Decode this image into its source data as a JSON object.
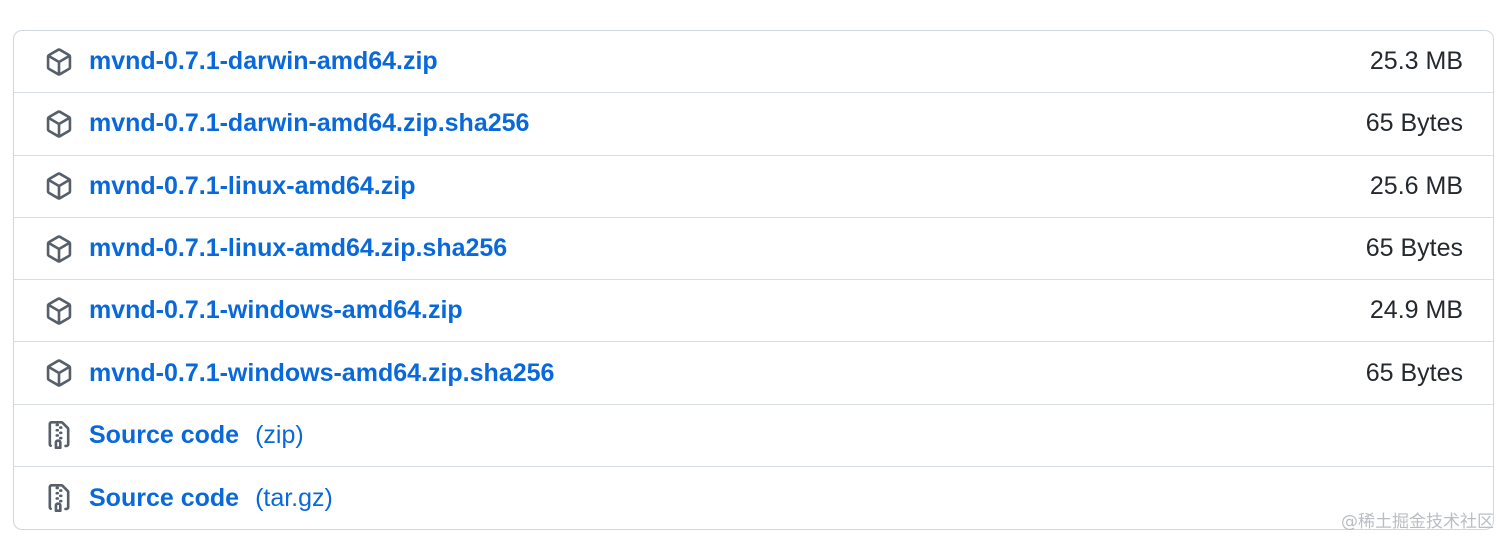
{
  "assets": [
    {
      "name": "mvnd-0.7.1-darwin-amd64.zip",
      "size": "25.3 MB",
      "icon": "package-icon"
    },
    {
      "name": "mvnd-0.7.1-darwin-amd64.zip.sha256",
      "size": "65 Bytes",
      "icon": "package-icon"
    },
    {
      "name": "mvnd-0.7.1-linux-amd64.zip",
      "size": "25.6 MB",
      "icon": "package-icon"
    },
    {
      "name": "mvnd-0.7.1-linux-amd64.zip.sha256",
      "size": "65 Bytes",
      "icon": "package-icon"
    },
    {
      "name": "mvnd-0.7.1-windows-amd64.zip",
      "size": "24.9 MB",
      "icon": "package-icon"
    },
    {
      "name": "mvnd-0.7.1-windows-amd64.zip.sha256",
      "size": "65 Bytes",
      "icon": "package-icon"
    }
  ],
  "source_code": [
    {
      "label": "Source code",
      "ext": "(zip)",
      "icon": "file-zip-icon"
    },
    {
      "label": "Source code",
      "ext": "(tar.gz)",
      "icon": "file-zip-icon"
    }
  ],
  "watermark": "@稀土掘金技术社区",
  "colors": {
    "link": "#0969da",
    "text": "#24292f",
    "border": "#d0d7de",
    "icon": "#57606a"
  }
}
